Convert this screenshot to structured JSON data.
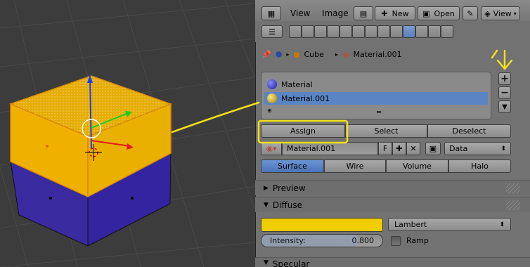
{
  "header": {
    "view_label": "View",
    "image_label": "Image",
    "new_label": "New",
    "open_label": "Open",
    "view2_label": "View"
  },
  "breadcrumb": {
    "object": "Cube",
    "material": "Material.001"
  },
  "material_slots": [
    {
      "name": "Material",
      "color": "#2a2aa8"
    },
    {
      "name": "Material.001",
      "color": "#c8a800"
    }
  ],
  "slot_actions": {
    "assign": "Assign",
    "select": "Select",
    "deselect": "Deselect"
  },
  "datablock": {
    "name": "Material.001",
    "fake_user": "F",
    "link_mode": "Data"
  },
  "render_tabs": [
    "Surface",
    "Wire",
    "Volume",
    "Halo"
  ],
  "render_tab_active": "Surface",
  "sections": {
    "preview": "Preview",
    "diffuse": "Diffuse",
    "specular": "Specular"
  },
  "diffuse": {
    "color": "#f0cd00",
    "shader": "Lambert",
    "intensity_label": "Intensity:",
    "intensity_value": "0.800",
    "intensity_fraction": 0.8,
    "ramp_label": "Ramp"
  },
  "colors": {
    "selected_slot": "#5b84c4",
    "active_tab": "#5a80c4",
    "annotation": "#f0e01a",
    "cube_top": "#f0b000",
    "cube_bottom": "#3a2aa0"
  }
}
